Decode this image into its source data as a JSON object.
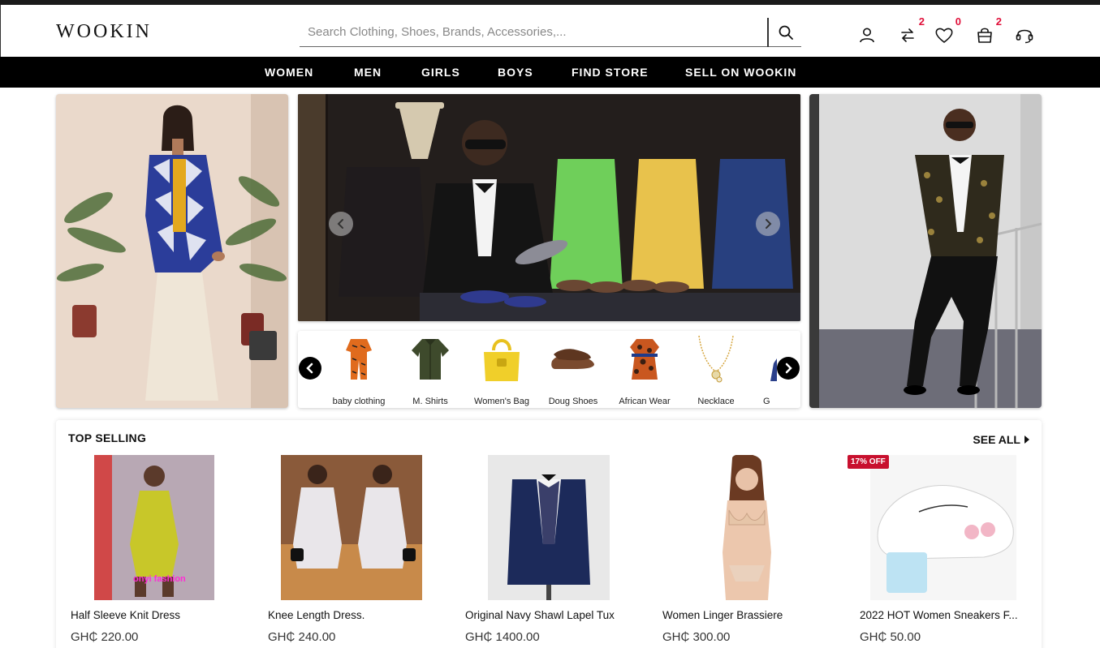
{
  "header": {
    "logo": "WOOKIN",
    "search_placeholder": "Search Clothing, Shoes, Brands, Accessories,...",
    "icons": [
      {
        "name": "user-icon",
        "badge": ""
      },
      {
        "name": "compare-icon",
        "badge": "2"
      },
      {
        "name": "heart-icon",
        "badge": "0"
      },
      {
        "name": "bag-icon",
        "badge": "2"
      },
      {
        "name": "headset-icon",
        "badge": ""
      }
    ],
    "badge_color": "#e0103a"
  },
  "nav": {
    "items": [
      "WOMEN",
      "MEN",
      "GIRLS",
      "BOYS",
      "FIND STORE",
      "SELL ON WOOKIN"
    ]
  },
  "categories": [
    {
      "label": "baby clothing",
      "icon": "baby-clothing-icon"
    },
    {
      "label": "M. Shirts",
      "icon": "shirt-icon"
    },
    {
      "label": "Women's Bag",
      "icon": "handbag-icon"
    },
    {
      "label": "Doug Shoes",
      "icon": "loafer-shoe-icon"
    },
    {
      "label": "African Wear",
      "icon": "african-dress-icon"
    },
    {
      "label": "Necklace",
      "icon": "necklace-icon"
    },
    {
      "label": "G",
      "icon": "partial-category-icon"
    }
  ],
  "top_selling": {
    "title": "TOP SELLING",
    "see_all": "SEE ALL",
    "products": [
      {
        "name": "Half Sleeve Knit Dress",
        "price": "GH₵ 220.00",
        "watermark": "onyi fashion",
        "badge": ""
      },
      {
        "name": "Knee Length Dress.",
        "price": "GH₵ 240.00",
        "badge": ""
      },
      {
        "name": "Original Navy Shawl Lapel Tux",
        "price": "GH₵ 1400.00",
        "badge": ""
      },
      {
        "name": "Women Linger Brassiere",
        "price": "GH₵ 300.00",
        "badge": ""
      },
      {
        "name": "2022 HOT Women Sneakers F...",
        "price": "GH₵ 50.00",
        "badge": "17% OFF"
      }
    ]
  },
  "colors": {
    "accent": "#e0103a",
    "nav_bg": "#000000",
    "discount": "#c8102e"
  }
}
